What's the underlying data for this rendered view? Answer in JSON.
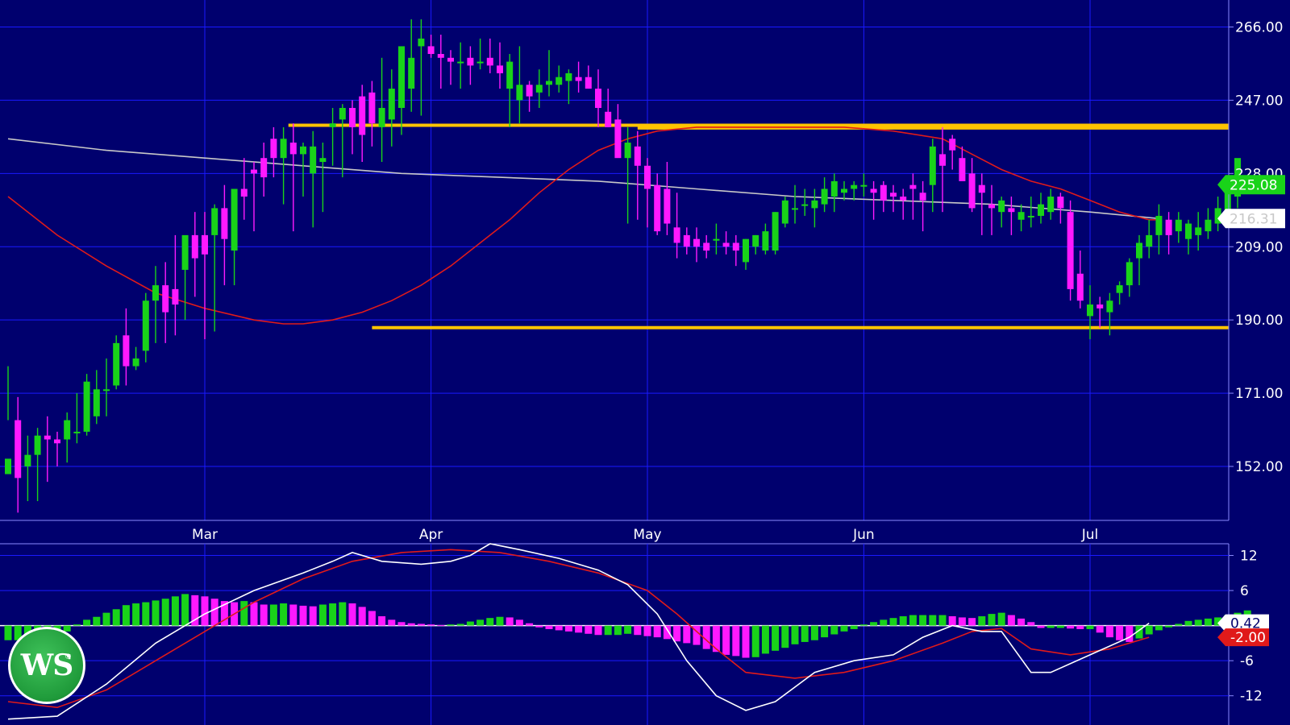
{
  "chart_data": [
    {
      "type": "candlestick",
      "y_ticks": [
        "266.00",
        "247.00",
        "228.00",
        "209.00",
        "190.00",
        "171.00",
        "152.00"
      ],
      "y_tick_values": [
        266,
        247,
        228,
        209,
        190,
        171,
        152
      ],
      "ylim": [
        138,
        273
      ],
      "x_labels": [
        "Mar",
        "Apr",
        "May",
        "Jun",
        "Jul"
      ],
      "x_label_index": [
        20,
        43,
        65,
        87,
        110
      ],
      "grid": true,
      "colors": {
        "up": "#19d319",
        "down": "#ff19ff",
        "background": "#00006e",
        "grid": "#1a1aff",
        "ma_fast": "#e01a1a",
        "ma_slow": "#c8c8c8",
        "levels": "#ffc400"
      },
      "price_tags": [
        {
          "value": 225.08,
          "label": "225.08",
          "color": "#19d319",
          "text_color": "#ffffff"
        },
        {
          "value": 216.31,
          "label": "216.31",
          "color": "#ffffff",
          "text_color": "#c8c8c8"
        }
      ],
      "horizontal_levels": [
        {
          "from_index": 28.5,
          "value": 240.5
        },
        {
          "from_index": 64,
          "value": 239.8
        },
        {
          "from_index": 37,
          "value": 188.0
        }
      ],
      "candles": [
        [
          150,
          178,
          164,
          154
        ],
        [
          164,
          170,
          140,
          149
        ],
        [
          152,
          160,
          143,
          155
        ],
        [
          155,
          162,
          143,
          160
        ],
        [
          160,
          165,
          148,
          159
        ],
        [
          159,
          161,
          152,
          158
        ],
        [
          159,
          166,
          153,
          164
        ],
        [
          161,
          171,
          158,
          161
        ],
        [
          161,
          176,
          160,
          174
        ],
        [
          165,
          177,
          163,
          172
        ],
        [
          172,
          180,
          165,
          172
        ],
        [
          173,
          186,
          172,
          184
        ],
        [
          186,
          193,
          173,
          178
        ],
        [
          178,
          183,
          177,
          180
        ],
        [
          182,
          197,
          179,
          195
        ],
        [
          195,
          204,
          184,
          199
        ],
        [
          199,
          205,
          184,
          192
        ],
        [
          198,
          212,
          186,
          194
        ],
        [
          203,
          206,
          190,
          212
        ],
        [
          212,
          218,
          196,
          206
        ],
        [
          212,
          218,
          185,
          207
        ],
        [
          212,
          220,
          187,
          219
        ],
        [
          219,
          225,
          199,
          211
        ],
        [
          208,
          222,
          199,
          224
        ],
        [
          224,
          232,
          216,
          222
        ],
        [
          229,
          231,
          213,
          228
        ],
        [
          232,
          236,
          222,
          227
        ],
        [
          237,
          240,
          227,
          232
        ],
        [
          232,
          240,
          220,
          237
        ],
        [
          236,
          241,
          213,
          233
        ],
        [
          233,
          236,
          222,
          235
        ],
        [
          228,
          239,
          214,
          235
        ],
        [
          231,
          236,
          218,
          232
        ],
        [
          240,
          245,
          230,
          241
        ],
        [
          242,
          246,
          227,
          245
        ],
        [
          245,
          247,
          233,
          240
        ],
        [
          248,
          251,
          231,
          238
        ],
        [
          249,
          252,
          235,
          241
        ],
        [
          240,
          258,
          231,
          245
        ],
        [
          242,
          255,
          235,
          250
        ],
        [
          245,
          259,
          238,
          261
        ],
        [
          250,
          268,
          244,
          258
        ],
        [
          261,
          268,
          243,
          263
        ],
        [
          261,
          264,
          258,
          259
        ],
        [
          259,
          264,
          250,
          258
        ],
        [
          258,
          260,
          251,
          257
        ],
        [
          257,
          262,
          250,
          257
        ],
        [
          258,
          261,
          251,
          256
        ],
        [
          257,
          263,
          255,
          257
        ],
        [
          258,
          263,
          254,
          256
        ],
        [
          256,
          262,
          250,
          254
        ],
        [
          250,
          259,
          240,
          257
        ],
        [
          247,
          261,
          241,
          251
        ],
        [
          251,
          252,
          244,
          248
        ],
        [
          249,
          255,
          245,
          251
        ],
        [
          251,
          260,
          248,
          252
        ],
        [
          251,
          256,
          249,
          253
        ],
        [
          252,
          255,
          246,
          254
        ],
        [
          253,
          257,
          249,
          252
        ],
        [
          253,
          256,
          250,
          250
        ],
        [
          250,
          255,
          240,
          245
        ],
        [
          244,
          250,
          240,
          240
        ],
        [
          242,
          246,
          235,
          232
        ],
        [
          232,
          240,
          215,
          236
        ],
        [
          235,
          239,
          216,
          230
        ],
        [
          230,
          232,
          214,
          224
        ],
        [
          225,
          228,
          212,
          213
        ],
        [
          224,
          231,
          212,
          215
        ],
        [
          214,
          223,
          206,
          210
        ],
        [
          212,
          214,
          207,
          209
        ],
        [
          211,
          214,
          205,
          209
        ],
        [
          210,
          212,
          206,
          208
        ],
        [
          211,
          215,
          207,
          211
        ],
        [
          210,
          213,
          207,
          209
        ],
        [
          210,
          212,
          204,
          208
        ],
        [
          205,
          211,
          203,
          211
        ],
        [
          209,
          212,
          207,
          212
        ],
        [
          208,
          215,
          207,
          213
        ],
        [
          208,
          218,
          207,
          218
        ],
        [
          215,
          222,
          214,
          221
        ],
        [
          219,
          225,
          215,
          219
        ],
        [
          220,
          224,
          217,
          220
        ],
        [
          219,
          224,
          214,
          221
        ],
        [
          220,
          227,
          218,
          224
        ],
        [
          222,
          228,
          218,
          226
        ],
        [
          223,
          226,
          221,
          224
        ],
        [
          224,
          226,
          221,
          225
        ],
        [
          225,
          228,
          222,
          225
        ],
        [
          224,
          226,
          216,
          223
        ],
        [
          225,
          226,
          218,
          221
        ],
        [
          223,
          225,
          218,
          222
        ],
        [
          222,
          224,
          216,
          221
        ],
        [
          225,
          228,
          216,
          224
        ],
        [
          223,
          226,
          213,
          221
        ],
        [
          225,
          237,
          218,
          235
        ],
        [
          233,
          240,
          218,
          230
        ],
        [
          237,
          238,
          229,
          234
        ],
        [
          232,
          235,
          228,
          226
        ],
        [
          228,
          232,
          218,
          219
        ],
        [
          225,
          228,
          212,
          223
        ],
        [
          220,
          225,
          212,
          219
        ],
        [
          218,
          222,
          214,
          221
        ],
        [
          219,
          222,
          212,
          218
        ],
        [
          216,
          220,
          213,
          218
        ],
        [
          217,
          222,
          214,
          217
        ],
        [
          217,
          223,
          215,
          220
        ],
        [
          218,
          224,
          216,
          222
        ],
        [
          222,
          223,
          215,
          219
        ],
        [
          218,
          221,
          195,
          198
        ],
        [
          202,
          208,
          193,
          195
        ],
        [
          191,
          199,
          185,
          194
        ],
        [
          194,
          196,
          188,
          193
        ],
        [
          192,
          197,
          186,
          195
        ],
        [
          197,
          200,
          194,
          199
        ],
        [
          199,
          206,
          196,
          205
        ],
        [
          206,
          212,
          199,
          210
        ],
        [
          209,
          216,
          206,
          212
        ],
        [
          212,
          220,
          207,
          217
        ],
        [
          216,
          218,
          207,
          212
        ],
        [
          213,
          218,
          210,
          216
        ],
        [
          211,
          216,
          207,
          215
        ],
        [
          212,
          218,
          208,
          214
        ],
        [
          213,
          219,
          211,
          216
        ],
        [
          215,
          222,
          213,
          219
        ],
        [
          218,
          225,
          216,
          225
        ],
        [
          222,
          229,
          219,
          232
        ]
      ],
      "moving_average_fast": [
        [
          0,
          222
        ],
        [
          5,
          212
        ],
        [
          10,
          204
        ],
        [
          15,
          197
        ],
        [
          20,
          193
        ],
        [
          25,
          190
        ],
        [
          28,
          189
        ],
        [
          30,
          189
        ],
        [
          33,
          190
        ],
        [
          36,
          192
        ],
        [
          39,
          195
        ],
        [
          42,
          199
        ],
        [
          45,
          204
        ],
        [
          48,
          210
        ],
        [
          51,
          216
        ],
        [
          54,
          223
        ],
        [
          57,
          229
        ],
        [
          60,
          234
        ],
        [
          63,
          237
        ],
        [
          66,
          239
        ],
        [
          70,
          240
        ],
        [
          75,
          240
        ],
        [
          80,
          240
        ],
        [
          85,
          240
        ],
        [
          90,
          239
        ],
        [
          95,
          237
        ],
        [
          98,
          233
        ],
        [
          101,
          229
        ],
        [
          104,
          226
        ],
        [
          107,
          224
        ],
        [
          110,
          221
        ],
        [
          113,
          218
        ],
        [
          116,
          216
        ],
        [
          117,
          216
        ]
      ],
      "moving_average_slow": [
        [
          0,
          237
        ],
        [
          10,
          234
        ],
        [
          20,
          232
        ],
        [
          30,
          230
        ],
        [
          40,
          228
        ],
        [
          50,
          227
        ],
        [
          60,
          226
        ],
        [
          70,
          224
        ],
        [
          80,
          222
        ],
        [
          90,
          221
        ],
        [
          100,
          220
        ],
        [
          110,
          218
        ],
        [
          117,
          216.31
        ]
      ]
    },
    {
      "type": "macd",
      "y_ticks": [
        "12",
        "6",
        "-6",
        "-12"
      ],
      "y_tick_values": [
        12,
        6,
        -6,
        -12
      ],
      "ylim": [
        -17,
        14
      ],
      "colors": {
        "pos_up": "#19d319",
        "neg_down": "#ff19ff",
        "zero": "#ffffff",
        "macd_line": "#ffffff",
        "signal_line": "#e01a1a"
      },
      "value_tags": [
        {
          "value": 0.42,
          "label": "0.42",
          "color": "#ffffff",
          "text_color": "#00006e"
        },
        {
          "value": -2.0,
          "label": "-2.00",
          "color": "#e01a1a",
          "text_color": "#ffffff"
        }
      ],
      "histogram": [
        -2.5,
        -2.5,
        -2.0,
        -2.0,
        -1.5,
        -1.5,
        -1.0,
        0.2,
        1.0,
        1.5,
        2.2,
        2.8,
        3.5,
        3.8,
        4.0,
        4.3,
        4.6,
        5.0,
        5.4,
        5.2,
        5.0,
        4.6,
        4.2,
        4.0,
        4.2,
        4.0,
        3.6,
        3.6,
        3.8,
        3.6,
        3.4,
        3.3,
        3.6,
        3.8,
        4.0,
        3.8,
        3.2,
        2.5,
        1.6,
        1.0,
        0.6,
        0.4,
        0.3,
        0.2,
        0.1,
        0.2,
        0.3,
        0.7,
        1.0,
        1.3,
        1.5,
        1.4,
        1.0,
        0.4,
        -0.3,
        -0.6,
        -0.8,
        -1.0,
        -1.2,
        -1.4,
        -1.6,
        -1.6,
        -1.6,
        -1.4,
        -1.6,
        -1.8,
        -2.0,
        -2.3,
        -2.7,
        -3.0,
        -3.3,
        -4.0,
        -4.5,
        -5.0,
        -5.2,
        -5.5,
        -5.4,
        -4.8,
        -4.3,
        -3.8,
        -3.2,
        -2.8,
        -2.5,
        -2.0,
        -1.5,
        -1.0,
        -0.6,
        0.2,
        0.6,
        1.0,
        1.3,
        1.6,
        1.8,
        1.8,
        1.8,
        1.8,
        1.6,
        1.4,
        1.3,
        1.6,
        2.0,
        2.2,
        1.8,
        1.2,
        0.6,
        -0.4,
        -0.4,
        -0.4,
        -0.5,
        -0.6,
        -0.6,
        -1.2,
        -2.0,
        -2.5,
        -2.8,
        -2.2,
        -1.5,
        -0.8,
        -0.3,
        0.3,
        0.8,
        1.0,
        1.2,
        1.4,
        1.8,
        2.2,
        2.6
      ],
      "macd_line": [
        [
          0,
          -16
        ],
        [
          5,
          -15.5
        ],
        [
          10,
          -10
        ],
        [
          15,
          -3
        ],
        [
          20,
          2
        ],
        [
          25,
          6
        ],
        [
          30,
          9
        ],
        [
          33,
          11
        ],
        [
          35,
          12.5
        ],
        [
          38,
          11
        ],
        [
          42,
          10.5
        ],
        [
          45,
          11
        ],
        [
          47,
          12
        ],
        [
          49,
          14
        ],
        [
          52,
          13
        ],
        [
          56,
          11.5
        ],
        [
          60,
          9.5
        ],
        [
          63,
          7
        ],
        [
          66,
          2
        ],
        [
          69,
          -6
        ],
        [
          72,
          -12
        ],
        [
          75,
          -14.5
        ],
        [
          78,
          -13
        ],
        [
          82,
          -8
        ],
        [
          86,
          -6
        ],
        [
          90,
          -5
        ],
        [
          93,
          -2
        ],
        [
          96,
          0
        ],
        [
          99,
          -1
        ],
        [
          101,
          -1
        ],
        [
          104,
          -8
        ],
        [
          106,
          -8
        ],
        [
          110,
          -5
        ],
        [
          114,
          -2
        ],
        [
          116,
          0.42
        ]
      ],
      "signal_line": [
        [
          0,
          -13
        ],
        [
          5,
          -14
        ],
        [
          10,
          -11
        ],
        [
          15,
          -6
        ],
        [
          20,
          -1
        ],
        [
          25,
          4
        ],
        [
          30,
          8
        ],
        [
          35,
          11
        ],
        [
          40,
          12.5
        ],
        [
          45,
          13
        ],
        [
          50,
          12.5
        ],
        [
          55,
          11
        ],
        [
          60,
          9
        ],
        [
          65,
          6
        ],
        [
          68,
          2
        ],
        [
          72,
          -4
        ],
        [
          75,
          -8
        ],
        [
          80,
          -9
        ],
        [
          85,
          -8
        ],
        [
          90,
          -6
        ],
        [
          95,
          -3
        ],
        [
          98,
          -1
        ],
        [
          101,
          -0.5
        ],
        [
          104,
          -4
        ],
        [
          108,
          -5
        ],
        [
          112,
          -4
        ],
        [
          116,
          -2.0
        ]
      ]
    }
  ],
  "logo": {
    "text": "WS",
    "mark": "®"
  }
}
